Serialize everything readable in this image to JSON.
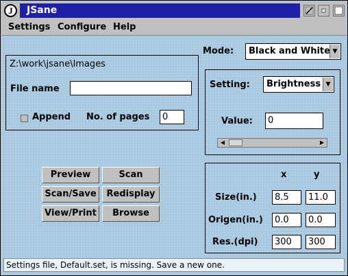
{
  "window": {
    "title": "JSane",
    "icon_letter": "J"
  },
  "menu": [
    "Settings",
    "Configure",
    "Help"
  ],
  "file_panel": {
    "path": "Z:\\work\\jsane\\Images",
    "file_name_label": "File name",
    "file_name_value": "",
    "append_label": "Append",
    "append_checked": false,
    "pages_label": "No. of pages",
    "pages_value": "0"
  },
  "mode": {
    "label": "Mode:",
    "value": "Black and White"
  },
  "setting_panel": {
    "label": "Setting:",
    "value": "Brightness",
    "value_label": "Value:",
    "value_input": "0"
  },
  "buttons": {
    "preview": "Preview",
    "scan": "Scan",
    "scan_save": "Scan/Save",
    "redisplay": "Redisplay",
    "view_print": "View/Print",
    "browse": "Browse"
  },
  "geometry": {
    "x_header": "x",
    "y_header": "y",
    "rows": [
      {
        "label": "Size(in.)",
        "x": "8.5",
        "y": "11.0"
      },
      {
        "label": "Origen(in.)",
        "x": "0.0",
        "y": "0.0"
      },
      {
        "label": "Res.(dpi)",
        "x": "300",
        "y": "300"
      }
    ]
  },
  "status": "Settings file, Default.set, is missing. Save a new one."
}
